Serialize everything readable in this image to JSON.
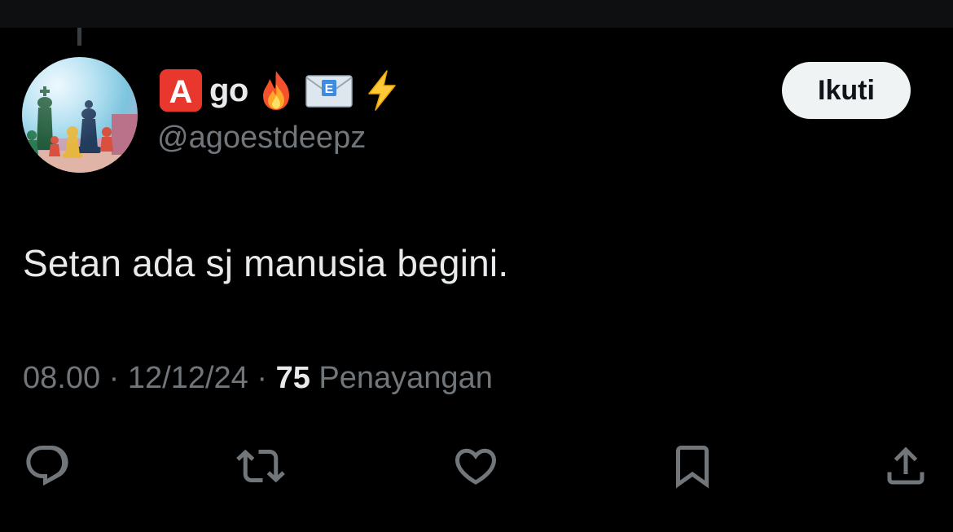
{
  "tweet": {
    "display_name": {
      "letter_emoji": "🅰️",
      "name": "go",
      "emojis": [
        "🔥",
        "📧",
        "⚡"
      ]
    },
    "handle": "@agoestdeepz",
    "follow_label": "Ikuti",
    "text": "Setan ada sj manusia begini.",
    "time": "08.00",
    "separator": "·",
    "date": "12/12/24",
    "views_count": "75",
    "views_label": "Penayangan"
  },
  "actions": [
    {
      "icon": "reply-icon"
    },
    {
      "icon": "retweet-icon"
    },
    {
      "icon": "like-icon"
    },
    {
      "icon": "bookmark-icon"
    },
    {
      "icon": "share-icon"
    }
  ],
  "colors": {
    "background": "#000000",
    "primary_text": "#e7e9ea",
    "secondary_text": "#71767b",
    "follow_button_bg": "#eff3f4",
    "follow_button_text": "#0f1419"
  }
}
